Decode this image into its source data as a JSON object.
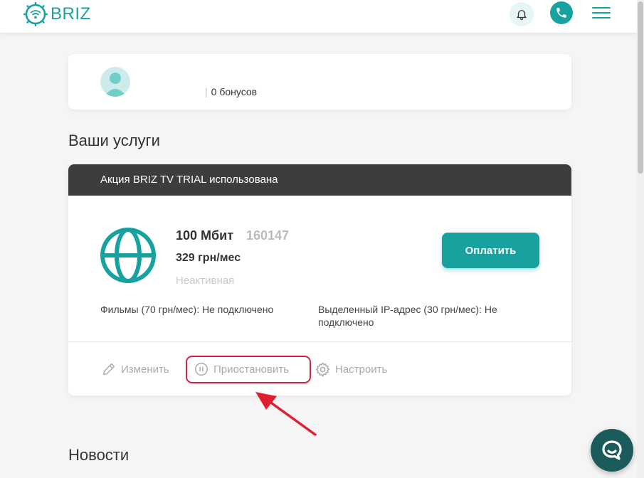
{
  "header": {
    "brand": "BRIZ",
    "bell_icon": "bell-icon",
    "phone_icon": "phone-icon",
    "menu_icon": "hamburger-menu-icon"
  },
  "profile": {
    "bonus_text": "0 бонусов"
  },
  "services": {
    "title": "Ваши услуги",
    "promo_banner": "Акция BRIZ TV TRIAL использована",
    "speed": "100 Мбит",
    "account_id": "160147",
    "price": "329 грн/мес",
    "status": "Неактивная",
    "pay_label": "Оплатить",
    "addon_movies": "Фильмы (70 грн/мес): Не подключено",
    "addon_ip": "Выделенный IP-адрес (30 грн/мес): Не подключено",
    "actions": {
      "edit": "Изменить",
      "pause": "Приостановить",
      "configure": "Настроить"
    }
  },
  "news": {
    "title": "Новости"
  },
  "colors": {
    "brand": "#17a2a0",
    "promo_bar": "#3d3d3d",
    "highlight": "#d9213f",
    "chat": "#1b5b5b"
  }
}
